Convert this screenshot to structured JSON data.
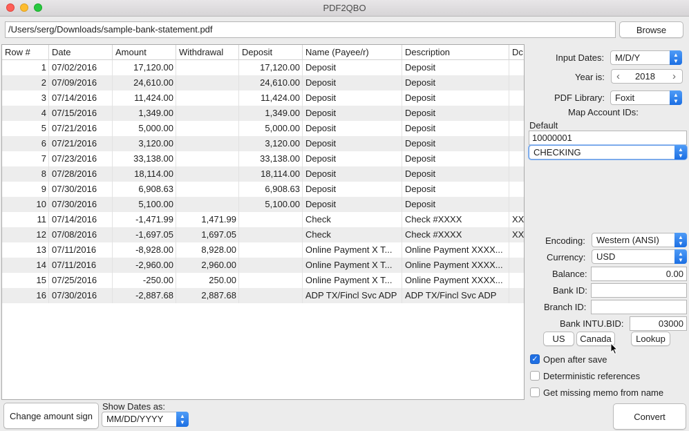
{
  "window": {
    "title": "PDF2QBO"
  },
  "file": {
    "path": "/Users/serg/Downloads/sample-bank-statement.pdf",
    "browse_label": "Browse"
  },
  "table": {
    "columns": [
      "Row #",
      "Date",
      "Amount",
      "Withdrawal",
      "Deposit",
      "Name (Payee/r)",
      "Description",
      "Dc"
    ],
    "rows": [
      [
        "1",
        "07/02/2016",
        "17,120.00",
        "",
        "17,120.00",
        "Deposit",
        "Deposit",
        ""
      ],
      [
        "2",
        "07/09/2016",
        "24,610.00",
        "",
        "24,610.00",
        "Deposit",
        "Deposit",
        ""
      ],
      [
        "3",
        "07/14/2016",
        "11,424.00",
        "",
        "11,424.00",
        "Deposit",
        "Deposit",
        ""
      ],
      [
        "4",
        "07/15/2016",
        "1,349.00",
        "",
        "1,349.00",
        "Deposit",
        "Deposit",
        ""
      ],
      [
        "5",
        "07/21/2016",
        "5,000.00",
        "",
        "5,000.00",
        "Deposit",
        "Deposit",
        ""
      ],
      [
        "6",
        "07/21/2016",
        "3,120.00",
        "",
        "3,120.00",
        "Deposit",
        "Deposit",
        ""
      ],
      [
        "7",
        "07/23/2016",
        "33,138.00",
        "",
        "33,138.00",
        "Deposit",
        "Deposit",
        ""
      ],
      [
        "8",
        "07/28/2016",
        "18,114.00",
        "",
        "18,114.00",
        "Deposit",
        "Deposit",
        ""
      ],
      [
        "9",
        "07/30/2016",
        "6,908.63",
        "",
        "6,908.63",
        "Deposit",
        "Deposit",
        ""
      ],
      [
        "10",
        "07/30/2016",
        "5,100.00",
        "",
        "5,100.00",
        "Deposit",
        "Deposit",
        ""
      ],
      [
        "11",
        "07/14/2016",
        "-1,471.99",
        "1,471.99",
        "",
        "Check",
        "Check #XXXX",
        "XX"
      ],
      [
        "12",
        "07/08/2016",
        "-1,697.05",
        "1,697.05",
        "",
        "Check",
        "Check #XXXX",
        "XX"
      ],
      [
        "13",
        "07/11/2016",
        "-8,928.00",
        "8,928.00",
        "",
        "Online Payment X T...",
        "Online Payment XXXX...",
        ""
      ],
      [
        "14",
        "07/11/2016",
        "-2,960.00",
        "2,960.00",
        "",
        "Online Payment X T...",
        "Online Payment XXXX...",
        ""
      ],
      [
        "15",
        "07/25/2016",
        "-250.00",
        "250.00",
        "",
        "Online Payment X T...",
        "Online Payment XXXX...",
        ""
      ],
      [
        "16",
        "07/30/2016",
        "-2,887.68",
        "2,887.68",
        "",
        "ADP TX/Fincl Svc ADP",
        "ADP TX/Fincl Svc ADP",
        ""
      ]
    ]
  },
  "settings": {
    "input_dates_label": "Input Dates:",
    "input_dates_value": "M/D/Y",
    "year_label": "Year is:",
    "year_value": "2018",
    "year_prev": "‹",
    "year_next": "›",
    "pdf_library_label": "PDF Library:",
    "pdf_library_value": "Foxit",
    "map_account_label": "Map Account IDs:",
    "default_label": "Default",
    "account_id": "10000001",
    "account_type": "CHECKING",
    "encoding_label": "Encoding:",
    "encoding_value": "Western (ANSI)",
    "currency_label": "Currency:",
    "currency_value": "USD",
    "balance_label": "Balance:",
    "balance_value": "0.00",
    "bank_id_label": "Bank ID:",
    "bank_id_value": "",
    "branch_id_label": "Branch ID:",
    "branch_id_value": "",
    "bank_intu_label": "Bank INTU.BID:",
    "bank_intu_value": "03000",
    "us_label": "US",
    "canada_label": "Canada",
    "lookup_label": "Lookup",
    "open_after_save_label": "Open after save",
    "open_after_save_checked": true,
    "deterministic_label": "Deterministic references",
    "deterministic_checked": false,
    "missing_memo_label": "Get missing memo from name",
    "missing_memo_checked": false
  },
  "bottom": {
    "change_sign_label": "Change amount sign",
    "show_dates_label": "Show Dates as:",
    "show_dates_value": "MM/DD/YYYY",
    "convert_label": "Convert"
  }
}
